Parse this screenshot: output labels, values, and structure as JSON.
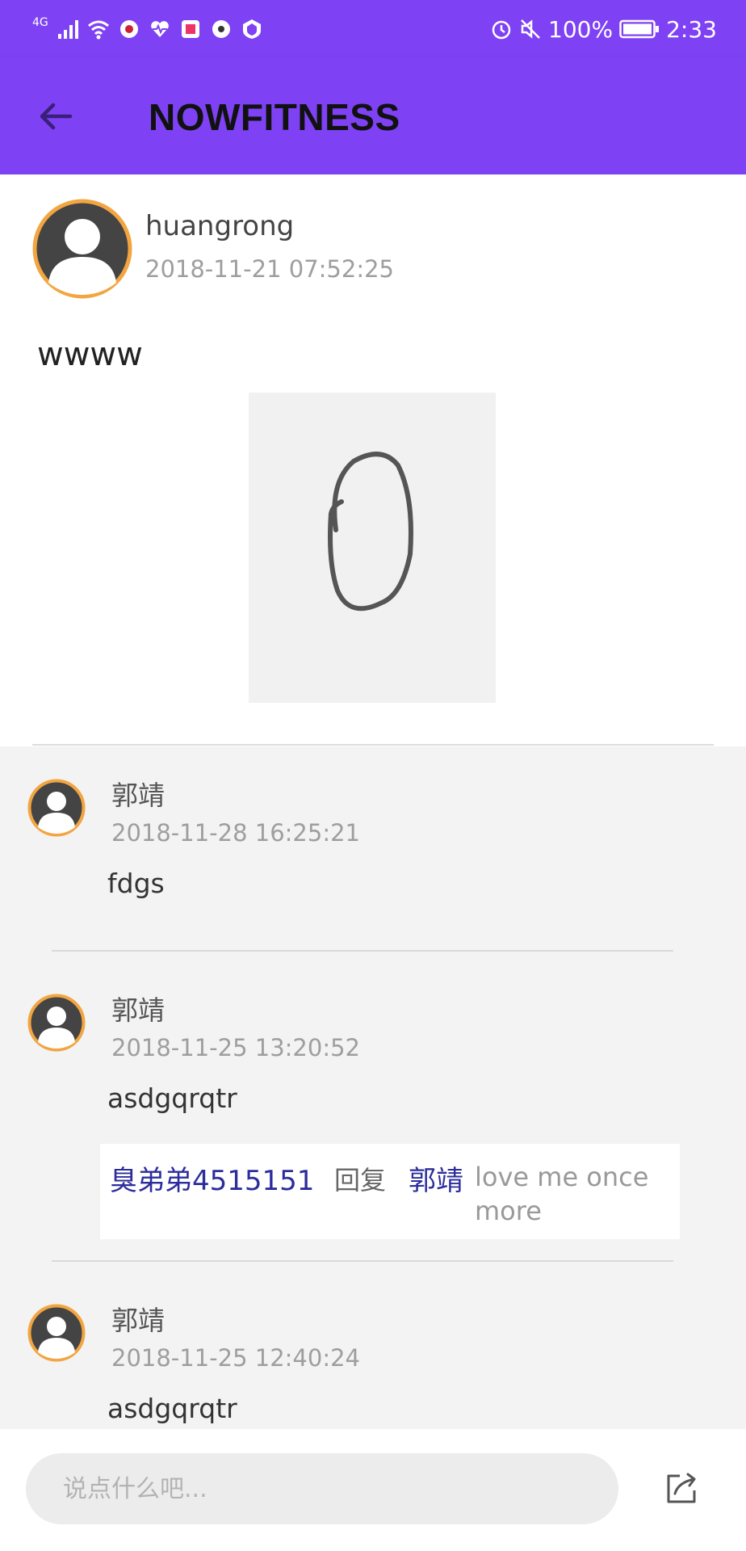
{
  "status_bar": {
    "network": "4G",
    "battery": "100%",
    "time": "2:33"
  },
  "appbar": {
    "title": "NOWFITNESS",
    "back_icon": "arrow-left-icon"
  },
  "post": {
    "username": "huangrong",
    "time": "2018-11-21 07:52:25",
    "content": "wwww"
  },
  "comments": [
    {
      "name": "郭靖",
      "time": "2018-11-28 16:25:21",
      "text": "fdgs"
    },
    {
      "name": "郭靖",
      "time": "2018-11-25 13:20:52",
      "text": "asdgqrqtr",
      "reply": {
        "from": "臭弟弟4515151",
        "word": "回复",
        "to": "郭靖",
        "message": "love me once more"
      }
    },
    {
      "name": "郭靖",
      "time": "2018-11-25 12:40:24",
      "text": "asdgqrqtr"
    }
  ],
  "bottom_bar": {
    "input_placeholder": "说点什么吧...",
    "share_icon": "share-icon"
  },
  "colors": {
    "primary": "#7e42f4",
    "avatar_ring": "#f2a541",
    "reply_name": "#2c2c9c"
  }
}
